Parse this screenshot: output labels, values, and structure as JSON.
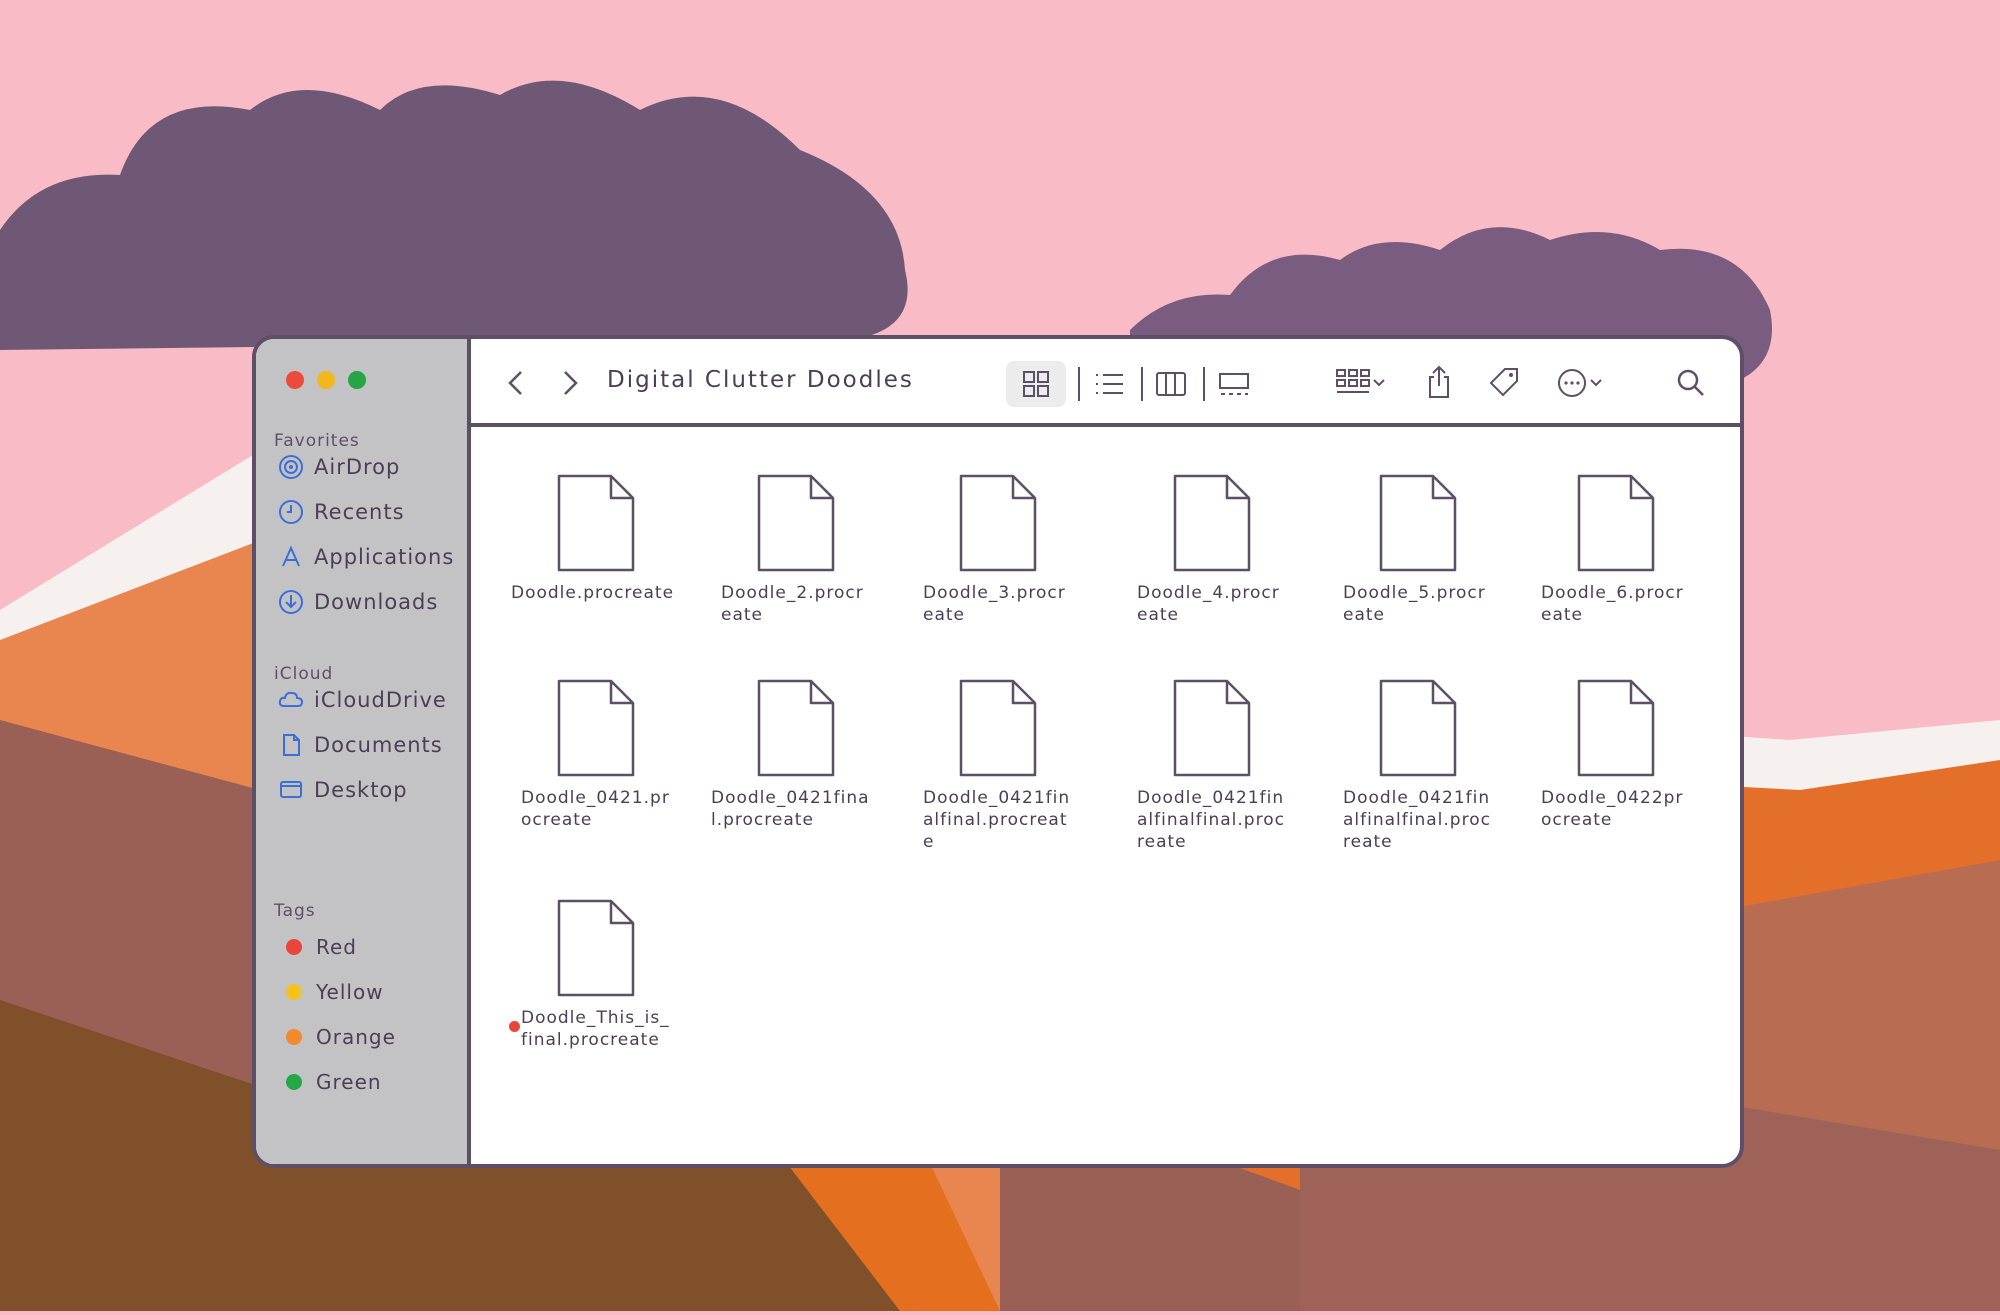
{
  "window": {
    "title": "Digital Clutter Doodles"
  },
  "sidebar": {
    "favorites_label": "Favorites",
    "favorites": [
      {
        "label": "AirDrop",
        "icon": "airdrop-icon"
      },
      {
        "label": "Recents",
        "icon": "clock-icon"
      },
      {
        "label": "Applications",
        "icon": "applications-icon"
      },
      {
        "label": "Downloads",
        "icon": "download-icon"
      }
    ],
    "icloud_label": "iCloud",
    "icloud": [
      {
        "label": "iCloudDrive",
        "icon": "cloud-icon"
      },
      {
        "label": "Documents",
        "icon": "document-icon"
      },
      {
        "label": "Desktop",
        "icon": "desktop-icon"
      }
    ],
    "tags_label": "Tags",
    "tags": [
      {
        "label": "Red",
        "color": "#e8463b"
      },
      {
        "label": "Yellow",
        "color": "#f3c21d"
      },
      {
        "label": "Orange",
        "color": "#f08a2c"
      },
      {
        "label": "Green",
        "color": "#22a845"
      }
    ]
  },
  "files": [
    {
      "name": "Doodle.procreate"
    },
    {
      "name": "Doodle_2.procreate"
    },
    {
      "name": "Doodle_3.procreate"
    },
    {
      "name": "Doodle_4.procreate"
    },
    {
      "name": "Doodle_5.procreate"
    },
    {
      "name": "Doodle_6.procreate"
    },
    {
      "name": "Doodle_0421.procreate"
    },
    {
      "name": "Doodle_0421final.procreate"
    },
    {
      "name": "Doodle_0421finalfinal.procreate"
    },
    {
      "name": "Doodle_0421finalfinalfinal.procreate"
    },
    {
      "name": "Doodle_0421finalfinalfinal.procreate"
    },
    {
      "name": "Doodle_0422procreate"
    },
    {
      "name": "Doodle_This_is_final.procreate",
      "tag": "#e8463b"
    }
  ],
  "colors": {
    "background": "#f9bcc6",
    "outline": "#5d5066",
    "sidebar": "#c3c3c5",
    "icon_blue": "#3b6fd6"
  }
}
